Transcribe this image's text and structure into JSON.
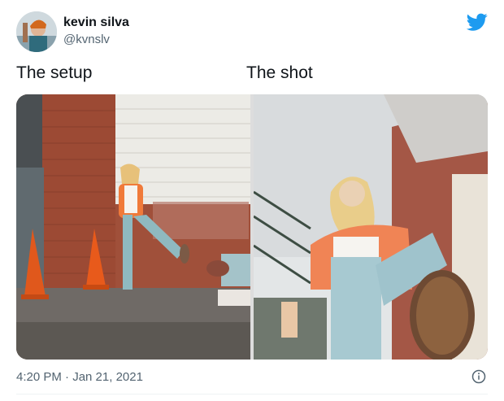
{
  "author": {
    "name": "kevin silva",
    "handle": "@kvnslv"
  },
  "icons": {
    "brand": "twitter-bird-icon",
    "info": "info-icon"
  },
  "colors": {
    "brand": "#1d9bf0",
    "muted": "#536471"
  },
  "captions": {
    "left": "The setup",
    "right": "The shot"
  },
  "timestamp": "4:20 PM · Jan 21, 2021"
}
